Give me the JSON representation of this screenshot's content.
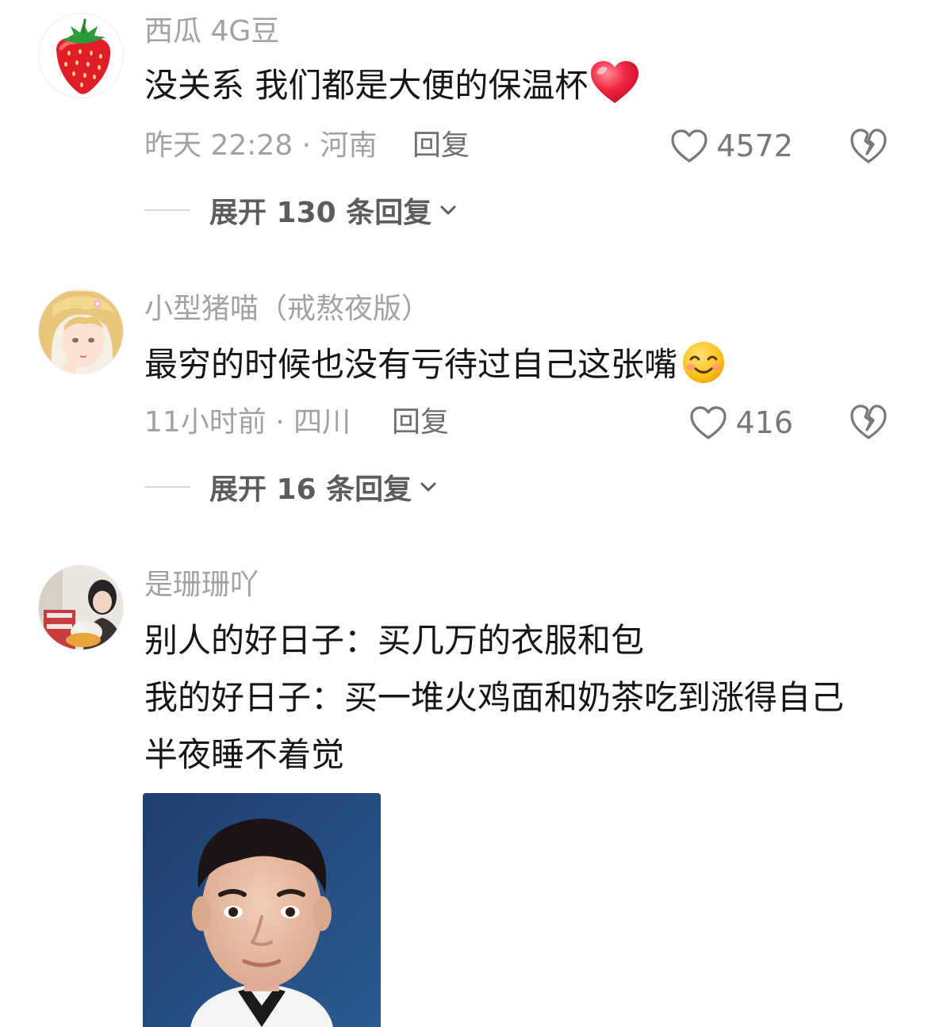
{
  "comments": [
    {
      "username": "西瓜 4G豆",
      "text_lines": [
        "没关系 我们都是大便的保温杯"
      ],
      "emoji": "red-heart-icon",
      "meta": "昨天 22:28 · 河南",
      "reply_label": "回复",
      "likes": "4572",
      "expand_label": "展开 130 条回复"
    },
    {
      "username": "小型猪喵（戒熬夜版）",
      "text_lines": [
        "最穷的时候也没有亏待过自己这张嘴"
      ],
      "emoji": "smiling-face-icon",
      "meta": "11小时前 · 四川",
      "reply_label": "回复",
      "likes": "416",
      "expand_label": "展开 16 条回复"
    },
    {
      "username": "是珊珊吖",
      "text_lines": [
        "别人的好日子：买几万的衣服和包",
        "我的好日子：买一堆火鸡面和奶茶吃到涨得自己",
        "半夜睡不着觉"
      ],
      "attachment": "photo-of-man-icon"
    }
  ],
  "colors": {
    "username": "#a1a1a6",
    "body_text": "#161616",
    "meta": "#a1a1a6",
    "reply": "#6e6e73",
    "expand_text": "#5c5c60",
    "heart_red": "#f0263f"
  }
}
